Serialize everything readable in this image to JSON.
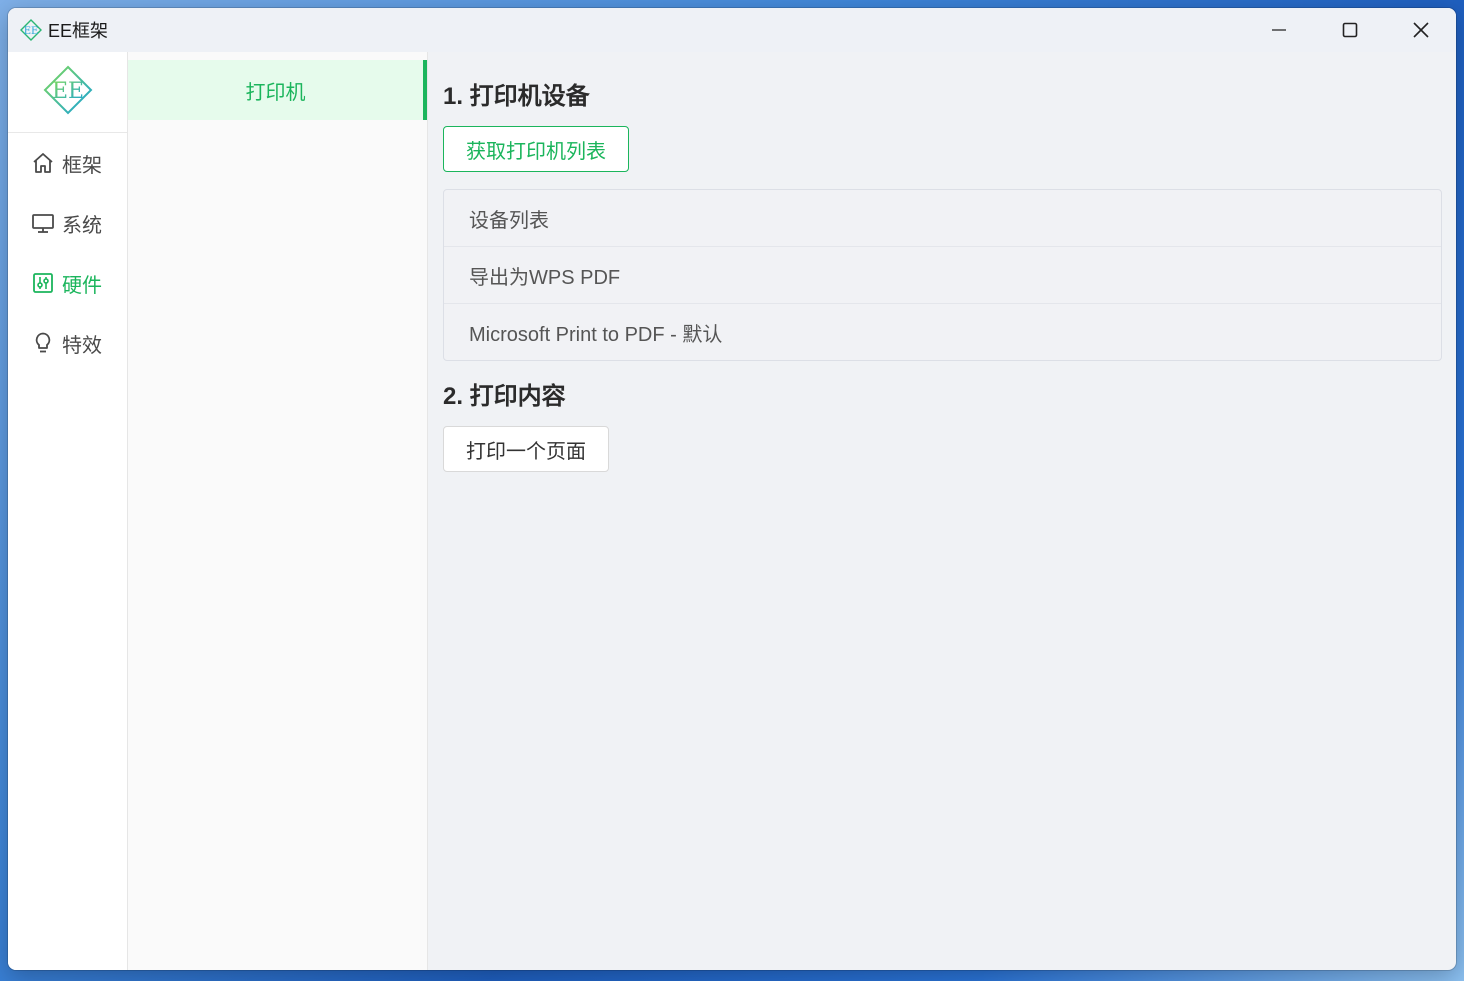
{
  "window": {
    "title": "EE框架",
    "controls": {
      "minimize": "minimize-icon",
      "maximize": "maximize-icon",
      "close": "close-icon"
    }
  },
  "nav": {
    "logo": "EE",
    "items": [
      {
        "label": "框架",
        "icon": "home-icon",
        "active": false
      },
      {
        "label": "系统",
        "icon": "monitor-icon",
        "active": false
      },
      {
        "label": "硬件",
        "icon": "hardware-icon",
        "active": true
      },
      {
        "label": "特效",
        "icon": "lightbulb-icon",
        "active": false
      }
    ]
  },
  "submenu": {
    "items": [
      {
        "label": "打印机",
        "active": true
      }
    ]
  },
  "main": {
    "section1": {
      "title": "1. 打印机设备",
      "button": "获取打印机列表",
      "devices": [
        "设备列表",
        "导出为WPS PDF",
        "Microsoft Print to PDF - 默认"
      ]
    },
    "section2": {
      "title": "2. 打印内容",
      "button": "打印一个页面"
    }
  },
  "colors": {
    "accent": "#1bb55c",
    "accent_bg": "#e6fbec",
    "content_bg": "#f0f2f5"
  }
}
